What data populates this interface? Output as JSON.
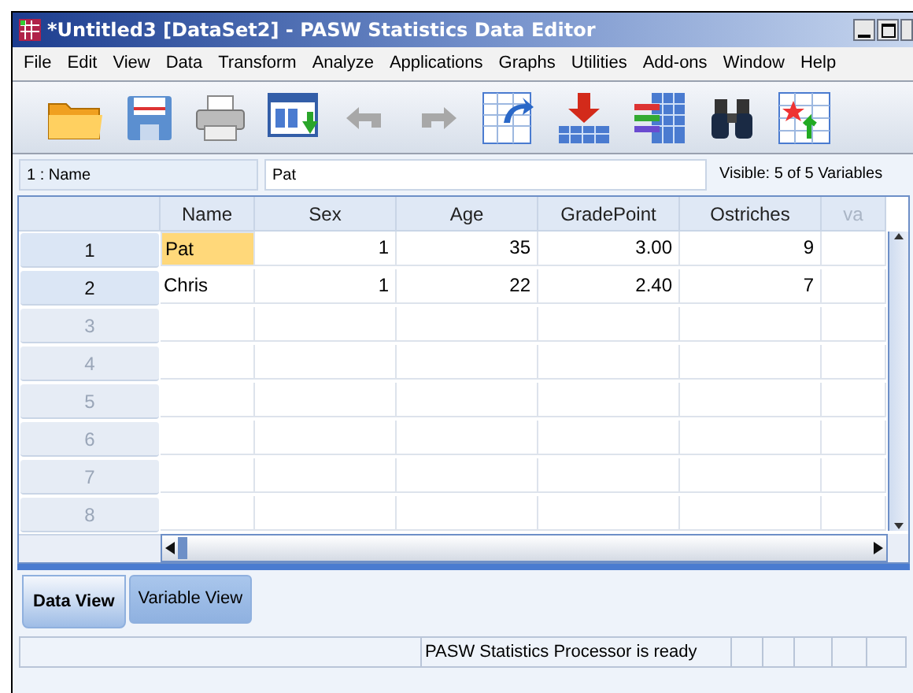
{
  "window": {
    "title": "*Untitled3 [DataSet2] - PASW Statistics Data Editor"
  },
  "menu": [
    "File",
    "Edit",
    "View",
    "Data",
    "Transform",
    "Analyze",
    "Applications",
    "Graphs",
    "Utilities",
    "Add-ons",
    "Window",
    "Help"
  ],
  "cell_editor": {
    "reference": "1 : Name",
    "value": "Pat",
    "visible": "Visible: 5 of 5 Variables"
  },
  "table": {
    "columns": [
      {
        "name": "Name",
        "kind": "string"
      },
      {
        "name": "Sex",
        "kind": "numeric"
      },
      {
        "name": "Age",
        "kind": "numeric"
      },
      {
        "name": "GradePoint",
        "kind": "numeric"
      },
      {
        "name": "Ostriches",
        "kind": "numeric"
      },
      {
        "name": "va",
        "kind": "placeholder"
      }
    ],
    "rows": [
      {
        "number": "1",
        "disabled": false,
        "cells": [
          {
            "value": "Pat",
            "selected": true
          },
          {
            "value": "1",
            "selected": false
          },
          {
            "value": "35",
            "selected": false
          },
          {
            "value": "3.00",
            "selected": false
          },
          {
            "value": "9",
            "selected": false
          }
        ]
      },
      {
        "number": "2",
        "disabled": false,
        "cells": [
          {
            "value": "Chris",
            "selected": false
          },
          {
            "value": "1",
            "selected": false
          },
          {
            "value": "22",
            "selected": false
          },
          {
            "value": "2.40",
            "selected": false
          },
          {
            "value": "7",
            "selected": false
          }
        ]
      },
      {
        "number": "3",
        "disabled": true
      },
      {
        "number": "4",
        "disabled": true
      },
      {
        "number": "5",
        "disabled": true
      },
      {
        "number": "6",
        "disabled": true
      },
      {
        "number": "7",
        "disabled": true
      },
      {
        "number": "8",
        "disabled": true
      }
    ]
  },
  "tabs": [
    {
      "label": "Data View",
      "selected": true
    },
    {
      "label": "Variable View",
      "selected": false
    }
  ],
  "status_bar": {
    "message": "PASW Statistics Processor is ready"
  }
}
